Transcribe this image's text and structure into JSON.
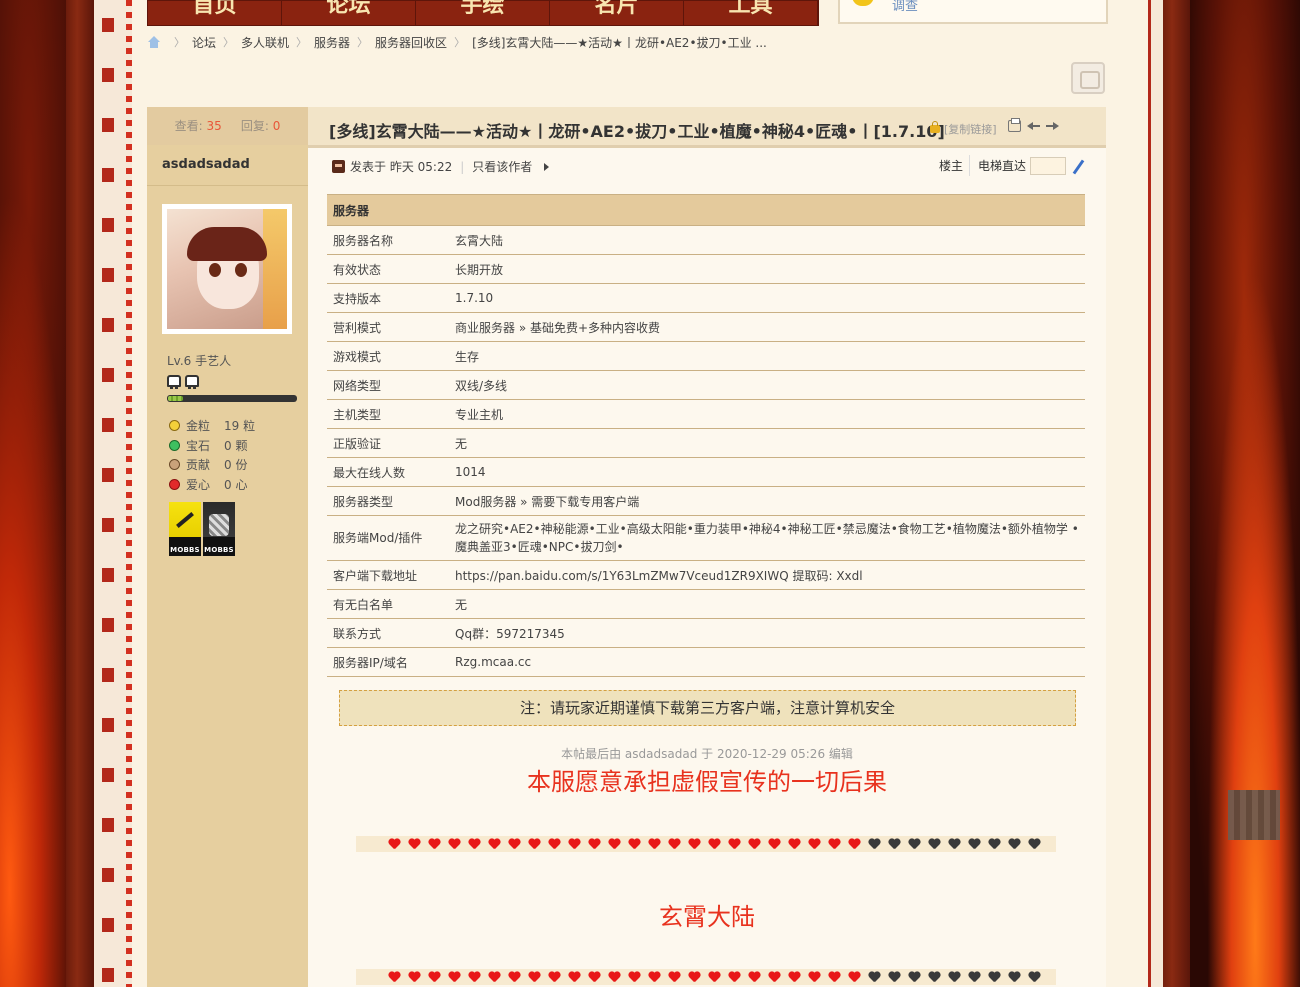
{
  "nav": {
    "items": [
      "首页",
      "论坛",
      "手绘",
      "名片",
      "工具"
    ]
  },
  "notice": {
    "text": "调查"
  },
  "breadcrumb": {
    "items": [
      "论坛",
      "多人联机",
      "服务器",
      "服务器回收区",
      "[多线]玄霄大陆——★活动★丨龙研•AE2•拔刀•工业 ..."
    ]
  },
  "stats": {
    "views_label": "查看:",
    "views": "35",
    "replies_label": "回复:",
    "replies": "0"
  },
  "author": {
    "username": "asdadsadad",
    "rank": "Lv.6 手艺人",
    "exp_fraction": 0.12,
    "credits": [
      {
        "icon": "gold-nugget-icon",
        "label": "金粒",
        "value": "19 粒"
      },
      {
        "icon": "emerald-icon",
        "label": "宝石",
        "value": "0 颗"
      },
      {
        "icon": "contribution-icon",
        "label": "贡献",
        "value": "0 份"
      },
      {
        "icon": "heart-icon",
        "label": "爱心",
        "value": "0 心"
      }
    ],
    "medals": [
      "MOBBS",
      "MOBBS"
    ]
  },
  "thread": {
    "title": "[多线]玄霄大陆——★活动★丨龙研•AE2•拔刀•工业•植魔•神秘4•匠魂•丨[1.7.10]",
    "copy_link": "[复制链接]"
  },
  "post": {
    "posted_prefix": "发表于",
    "posted_time": "昨天 05:22",
    "author_only": "只看该作者",
    "floor": "楼主",
    "jump_label": "电梯直达",
    "jump_value": ""
  },
  "table": {
    "header": "服务器",
    "rows": [
      {
        "label": "服务器名称",
        "value": "玄霄大陆"
      },
      {
        "label": "有效状态",
        "value": "长期开放"
      },
      {
        "label": "支持版本",
        "value": "1.7.10"
      },
      {
        "label": "营利模式",
        "value": "商业服务器 » 基础免费+多种内容收费"
      },
      {
        "label": "游戏模式",
        "value": "生存"
      },
      {
        "label": "网络类型",
        "value": "双线/多线"
      },
      {
        "label": "主机类型",
        "value": "专业主机"
      },
      {
        "label": "正版验证",
        "value": "无"
      },
      {
        "label": "最大在线人数",
        "value": "1014"
      },
      {
        "label": "服务器类型",
        "value": "Mod服务器 » 需要下载专用客户端"
      },
      {
        "label": "服务端Mod/插件",
        "value": "龙之研究•AE2•神秘能源•工业•高级太阳能•重力装甲•神秘4•神秘工匠•禁忌魔法•食物工艺•植物魔法•额外植物学 •魔典盖亚3•匠魂•NPC•拔刀剑•"
      },
      {
        "label": "客户端下载地址",
        "value": "https://pan.baidu.com/s/1Y63LmZMw7Vceud1ZR9XIWQ 提取码: Xxdl"
      },
      {
        "label": "有无白名单",
        "value": "无"
      },
      {
        "label": "联系方式",
        "value": "Qq群：597217345"
      },
      {
        "label": "服务器IP/域名",
        "value": "Rzg.mcaa.cc"
      }
    ]
  },
  "warning": "注：请玩家近期谨慎下载第三方客户端，注意计算机安全",
  "edit_note": "本帖最后由 asdadsadad 于 2020-12-29 05:26 编辑",
  "disclaimer": "本服愿意承担虚假宣传的一切后果",
  "hearts": {
    "filled": 24,
    "empty": 9
  },
  "server_name": "玄霄大陆",
  "colors": {
    "accent_red": "#e8321e",
    "nav_bg": "#8a2310",
    "author_bg": "#e6cf9f",
    "table_header_bg": "#e4ca9c"
  }
}
